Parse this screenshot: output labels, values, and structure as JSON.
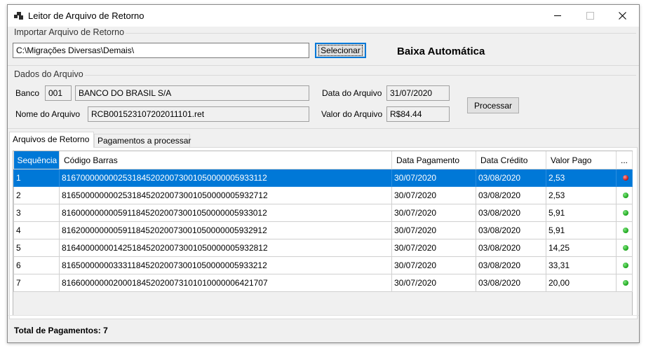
{
  "window": {
    "title": "Leitor de Arquivo de Retorno"
  },
  "import_group": {
    "label": "Importar Arquivo de Retorno",
    "path_value": "C:\\Migrações Diversas\\Demais\\",
    "select_label": "Selecionar",
    "heading": "Baixa Automática"
  },
  "file_group": {
    "label": "Dados do Arquivo",
    "banco_label": "Banco",
    "banco_code": "001",
    "banco_name": "BANCO DO BRASIL  S/A",
    "data_label": "Data do Arquivo",
    "data_value": "31/07/2020",
    "nome_label": "Nome do Arquivo",
    "nome_value": "RCB001523107202011101.ret",
    "valor_label": "Valor do Arquivo",
    "valor_value": "R$84.44",
    "process_label": "Processar"
  },
  "tabs": [
    {
      "label": "Arquivos de Retorno",
      "active": true
    },
    {
      "label": "Pagamentos a processar",
      "active": false
    }
  ],
  "grid": {
    "columns": [
      "Sequência",
      "Código Barras",
      "Data Pagamento",
      "Data Crédito",
      "Valor Pago",
      "..."
    ],
    "rows": [
      {
        "seq": "1",
        "codigo": "81670000000025318452020073001050000005933112",
        "pagamento": "30/07/2020",
        "credito": "03/08/2020",
        "valor": "2,53",
        "status": "red",
        "selected": true
      },
      {
        "seq": "2",
        "codigo": "81650000000025318452020073001050000005932712",
        "pagamento": "30/07/2020",
        "credito": "03/08/2020",
        "valor": "2,53",
        "status": "green",
        "selected": false
      },
      {
        "seq": "3",
        "codigo": "81600000000059118452020073001050000005933012",
        "pagamento": "30/07/2020",
        "credito": "03/08/2020",
        "valor": "5,91",
        "status": "green",
        "selected": false
      },
      {
        "seq": "4",
        "codigo": "81620000000059118452020073001050000005932912",
        "pagamento": "30/07/2020",
        "credito": "03/08/2020",
        "valor": "5,91",
        "status": "green",
        "selected": false
      },
      {
        "seq": "5",
        "codigo": "81640000000142518452020073001050000005932812",
        "pagamento": "30/07/2020",
        "credito": "03/08/2020",
        "valor": "14,25",
        "status": "green",
        "selected": false
      },
      {
        "seq": "6",
        "codigo": "81650000000333118452020073001050000005933212",
        "pagamento": "30/07/2020",
        "credito": "03/08/2020",
        "valor": "33,31",
        "status": "green",
        "selected": false
      },
      {
        "seq": "7",
        "codigo": "81660000000200018452020073101010000006421707",
        "pagamento": "30/07/2020",
        "credito": "03/08/2020",
        "valor": "20,00",
        "status": "green",
        "selected": false
      }
    ]
  },
  "footer": {
    "total_label": "Total de Pagamentos: 7"
  },
  "colors": {
    "selection": "#0078d7",
    "status_green": "#19a319",
    "status_red": "#c01010"
  }
}
